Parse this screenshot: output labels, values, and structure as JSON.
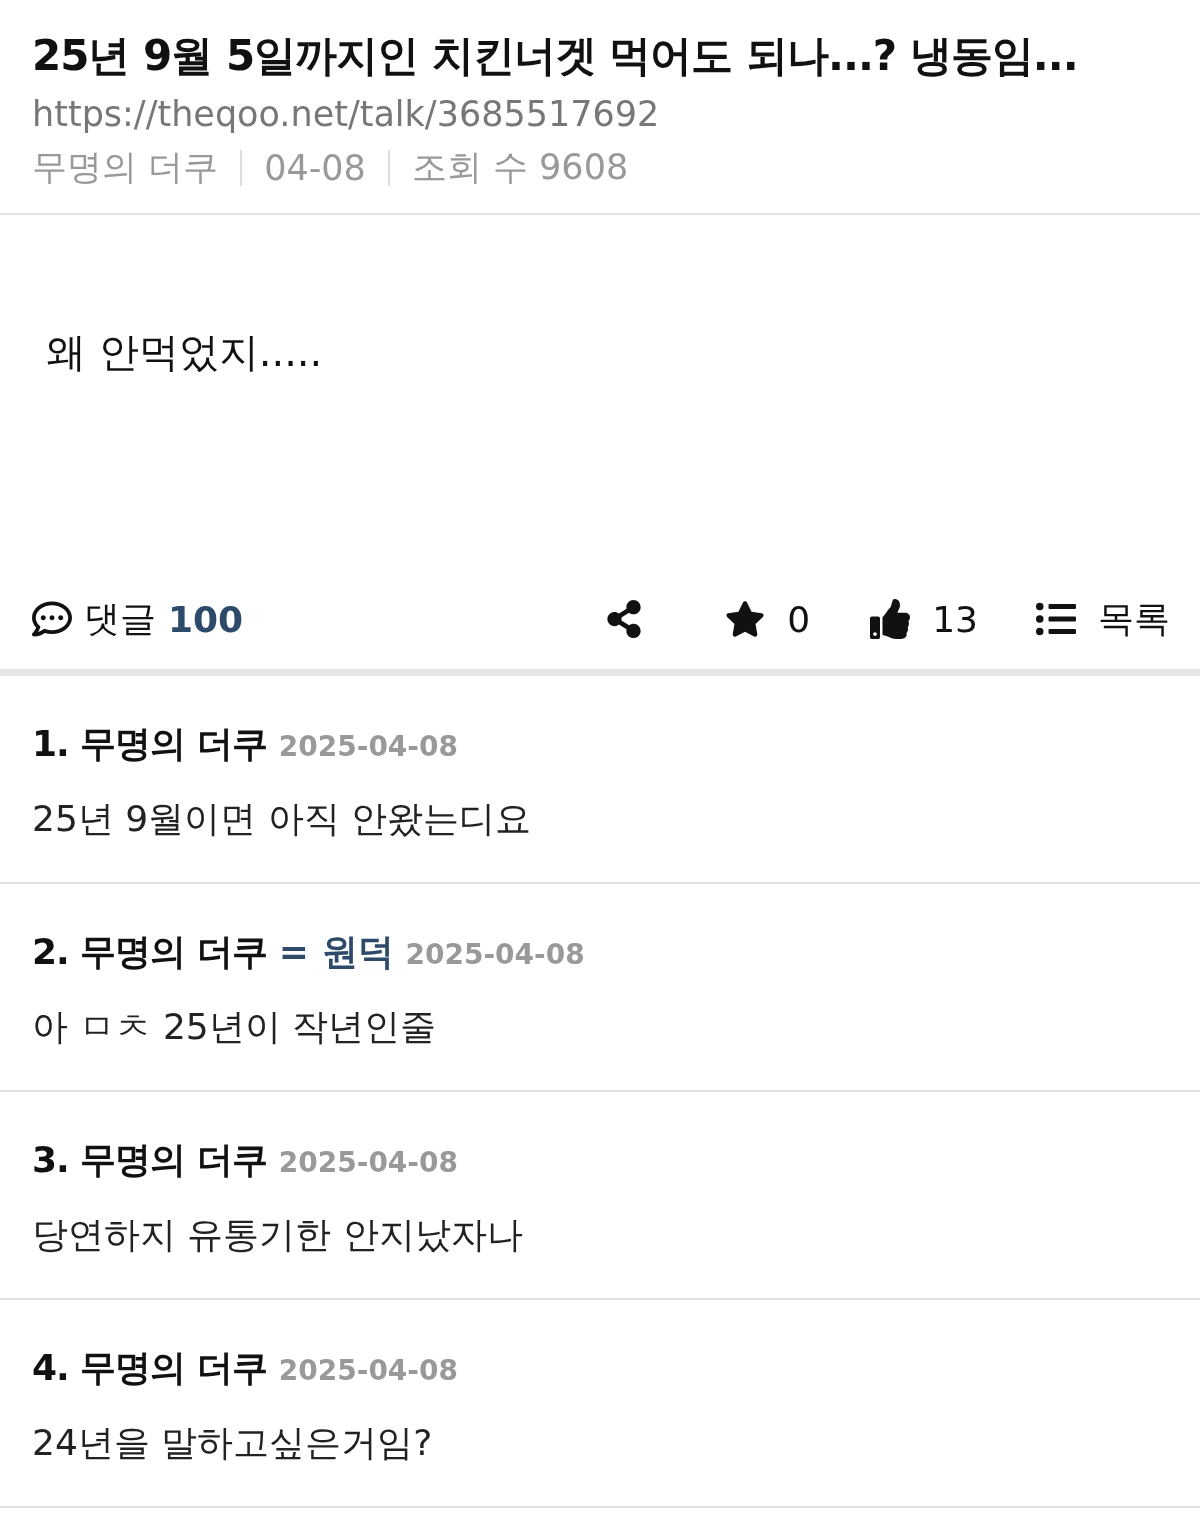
{
  "post": {
    "title": "25년 9월 5일까지인 치킨너겟 먹어도 되나...? 냉동임...",
    "url": "https://theqoo.net/talk/3685517692",
    "author": "무명의 더쿠",
    "date": "04-08",
    "views": "조회 수 9608",
    "body": "왜 안먹었지....."
  },
  "actions": {
    "comments_label": "댓글",
    "comments_count": "100",
    "stars": "0",
    "likes": "13",
    "list_label": "목록"
  },
  "comments": [
    {
      "number": "1.",
      "author": "무명의 더쿠",
      "date": "2025-04-08",
      "text": "25년 9월이면 아직 안왔는디요"
    },
    {
      "number": "2.",
      "author": "무명의 더쿠",
      "tag": "= 원덕",
      "date": "2025-04-08",
      "text": "아 ㅁㅊ 25년이 작년인줄"
    },
    {
      "number": "3.",
      "author": "무명의 더쿠",
      "date": "2025-04-08",
      "text": "당연하지 유통기한 안지났자나"
    },
    {
      "number": "4.",
      "author": "무명의 더쿠",
      "date": "2025-04-08",
      "text": "24년을 말하고싶은거임?"
    }
  ]
}
